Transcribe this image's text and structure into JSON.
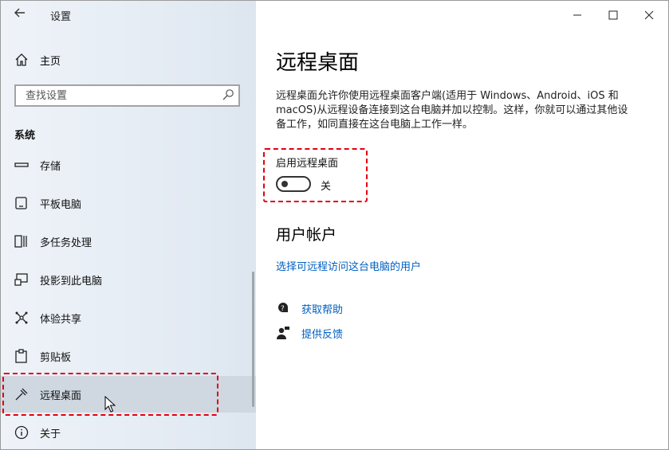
{
  "window": {
    "title": "设置",
    "controls": [
      "minimize-icon",
      "maximize-icon",
      "close-icon"
    ]
  },
  "sidebar": {
    "home_label": "主页",
    "search_placeholder": "查找设置",
    "section_label": "系统",
    "items": [
      {
        "label": "存储",
        "icon": "storage-icon"
      },
      {
        "label": "平板电脑",
        "icon": "tablet-icon"
      },
      {
        "label": "多任务处理",
        "icon": "multitasking-icon"
      },
      {
        "label": "投影到此电脑",
        "icon": "project-icon"
      },
      {
        "label": "体验共享",
        "icon": "share-icon"
      },
      {
        "label": "剪贴板",
        "icon": "clipboard-icon"
      },
      {
        "label": "远程桌面",
        "icon": "remote-desktop-icon",
        "selected": true
      },
      {
        "label": "关于",
        "icon": "info-icon"
      }
    ]
  },
  "main": {
    "title": "远程桌面",
    "description": "远程桌面允许你使用远程桌面客户端(适用于 Windows、Android、iOS 和 macOS)从远程设备连接到这台电脑并加以控制。这样，你就可以通过其他设备工作，如同直接在这台电脑上工作一样。",
    "toggle_label": "启用远程桌面",
    "toggle_state": "关",
    "toggle_on": false,
    "accounts_heading": "用户帐户",
    "accounts_link": "选择可远程访问这台电脑的用户",
    "help_links": [
      {
        "label": "获取帮助",
        "icon": "help-chat-icon"
      },
      {
        "label": "提供反馈",
        "icon": "feedback-icon"
      }
    ]
  },
  "colors": {
    "accent_link": "#0060c0",
    "highlight": "#e3000f",
    "selected_bg": "#cfd8e1"
  }
}
